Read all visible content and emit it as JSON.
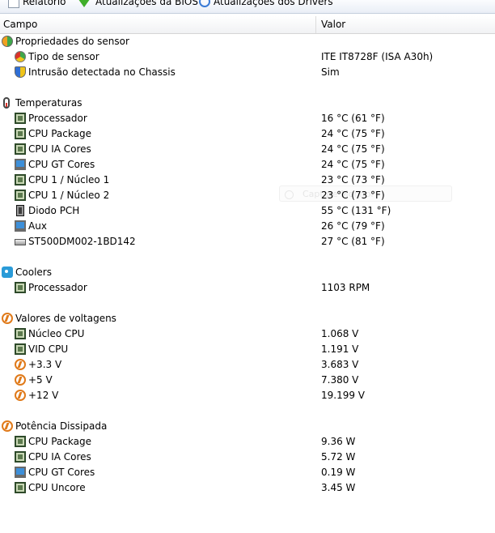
{
  "toolbar": {
    "items": [
      {
        "label": "Relatório",
        "icon": "report-icon"
      },
      {
        "label": "Atualizações da BIOS",
        "icon": "download-arrow-icon"
      },
      {
        "label": "Atualizações dos Drivers",
        "icon": "magnifier-icon"
      }
    ]
  },
  "columns": {
    "field": "Campo",
    "value": "Valor"
  },
  "groups": {
    "sensor": {
      "title": "Propriedades do sensor",
      "rows": [
        {
          "name": "Tipo de sensor",
          "value": "ITE IT8728F  (ISA A30h)"
        },
        {
          "name": "Intrusão detectada no Chassis",
          "value": "Sim"
        }
      ]
    },
    "temps": {
      "title": "Temperaturas",
      "rows": [
        {
          "name": "Processador",
          "value": "16 °C  (61 °F)"
        },
        {
          "name": "CPU Package",
          "value": "24 °C  (75 °F)"
        },
        {
          "name": "CPU IA Cores",
          "value": "24 °C  (75 °F)"
        },
        {
          "name": "CPU GT Cores",
          "value": "24 °C  (75 °F)"
        },
        {
          "name": "CPU 1 / Núcleo 1",
          "value": "23 °C  (73 °F)"
        },
        {
          "name": "CPU 1 / Núcleo 2",
          "value": "23 °C  (73 °F)"
        },
        {
          "name": "Diodo PCH",
          "value": "55 °C  (131 °F)"
        },
        {
          "name": "Aux",
          "value": "26 °C  (79 °F)"
        },
        {
          "name": "ST500DM002-1BD142",
          "value": "27 °C  (81 °F)"
        }
      ]
    },
    "coolers": {
      "title": "Coolers",
      "rows": [
        {
          "name": "Processador",
          "value": "1103 RPM"
        }
      ]
    },
    "volts": {
      "title": "Valores de voltagens",
      "rows": [
        {
          "name": "Núcleo CPU",
          "value": "1.068 V"
        },
        {
          "name": "VID CPU",
          "value": "1.191 V"
        },
        {
          "name": "+3.3 V",
          "value": "3.683 V"
        },
        {
          "name": "+5 V",
          "value": "7.380 V"
        },
        {
          "name": "+12 V",
          "value": "19.199 V"
        }
      ]
    },
    "power": {
      "title": "Potência Dissipada",
      "rows": [
        {
          "name": "CPU Package",
          "value": "9.36 W"
        },
        {
          "name": "CPU IA Cores",
          "value": "5.72 W"
        },
        {
          "name": "CPU GT Cores",
          "value": "0.19 W"
        },
        {
          "name": "CPU Uncore",
          "value": "3.45 W"
        }
      ]
    }
  },
  "ghost_label": "Capture Monitor"
}
